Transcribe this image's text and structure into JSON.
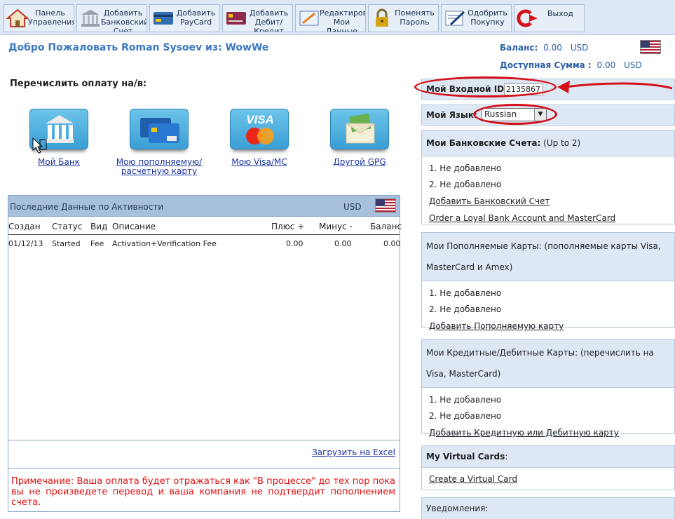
{
  "toolbar": {
    "items": [
      {
        "label": "Панель\nУправления",
        "icon": "home-icon"
      },
      {
        "label": "Добавить\nБанковский\nСчет",
        "icon": "bank-icon"
      },
      {
        "label": "Добавить\nPayCard",
        "icon": "card-icon"
      },
      {
        "label": "Добавить\nДебит/\nКредит",
        "icon": "credit-card-icon"
      },
      {
        "label": "Редактирова\nМои Данные",
        "icon": "edit-icon"
      },
      {
        "label": "Поменять\nПароль",
        "icon": "lock-icon"
      },
      {
        "label": "Одобрить\nПокупку",
        "icon": "approve-icon"
      },
      {
        "label": "Выход",
        "icon": "logout-icon"
      }
    ]
  },
  "header": {
    "welcome": "Добро Пожаловать Roman Sysoev из: WowWe",
    "balance_label": "Баланс:",
    "balance_value": "0.00",
    "balance_currency": "USD",
    "available_label": "Доступная Сумма :",
    "available_value": "0.00",
    "available_currency": "USD"
  },
  "transfer": {
    "title": "Перечислить оплату на/в:",
    "options": [
      {
        "label": "Мой Банк",
        "icon": "bank-building-icon"
      },
      {
        "label": "Мою пополняемую/\nрасчетную карту",
        "icon": "cards-icon"
      },
      {
        "label": "Мою Visa/MC",
        "icon": "visa-mastercard-icon"
      },
      {
        "label": "Другой GPG",
        "icon": "money-envelope-icon"
      }
    ]
  },
  "activity": {
    "title": "Последние Данные по Активности",
    "currency": "USD",
    "columns": [
      "Создан",
      "Статус",
      "Вид",
      "Описание",
      "Плюс +",
      "Минус -",
      "Баланс"
    ],
    "rows": [
      [
        "01/12/13",
        "Started",
        "Fee",
        "Activation+Verification Fee",
        "0.00",
        "0.00",
        "0.00"
      ]
    ],
    "excel_link": "Загрузить на Excel",
    "note": "Примечание: Ваша оплата будет отражаться как \"В процессе\" до тех пор пока вы не произведете перевод и ваша компания не подтвердит пополнением счета."
  },
  "account": {
    "login_label": "Мой Входной ID:",
    "login_value": "2135867",
    "language_label": "Мой Язык:",
    "language_value": "Russian"
  },
  "bank_accounts": {
    "title": "Мои Банковские Счета:",
    "subtitle": "(Up to 2)",
    "items": [
      "1. Не добавлено",
      "2. Не добавлено"
    ],
    "links": [
      "Добавить Банковский Счет",
      "Order a Loyal Bank Account and MasterCard"
    ]
  },
  "reload_cards": {
    "title": "Мои Пополняемые Карты: (пополняемые карты Visa, MasterCard и Amex)",
    "items": [
      "1. Не добавлено",
      "2. Не добавлено"
    ],
    "link": "Добавить Пополняемую карту"
  },
  "credit_cards": {
    "title": "Мои Кредитные/Дебитные Карты: (перечислить на Visa, MasterCard)",
    "items": [
      "1. Не добавлено",
      "2.  Не добавлено"
    ],
    "link": "Добавить Кредитную или Дебитную карту"
  },
  "virtual_cards": {
    "title": "My Virtual Cards",
    "title_suffix": ":",
    "link": "Create a Virtual Card"
  },
  "notifications": {
    "title": "Уведомления:"
  }
}
